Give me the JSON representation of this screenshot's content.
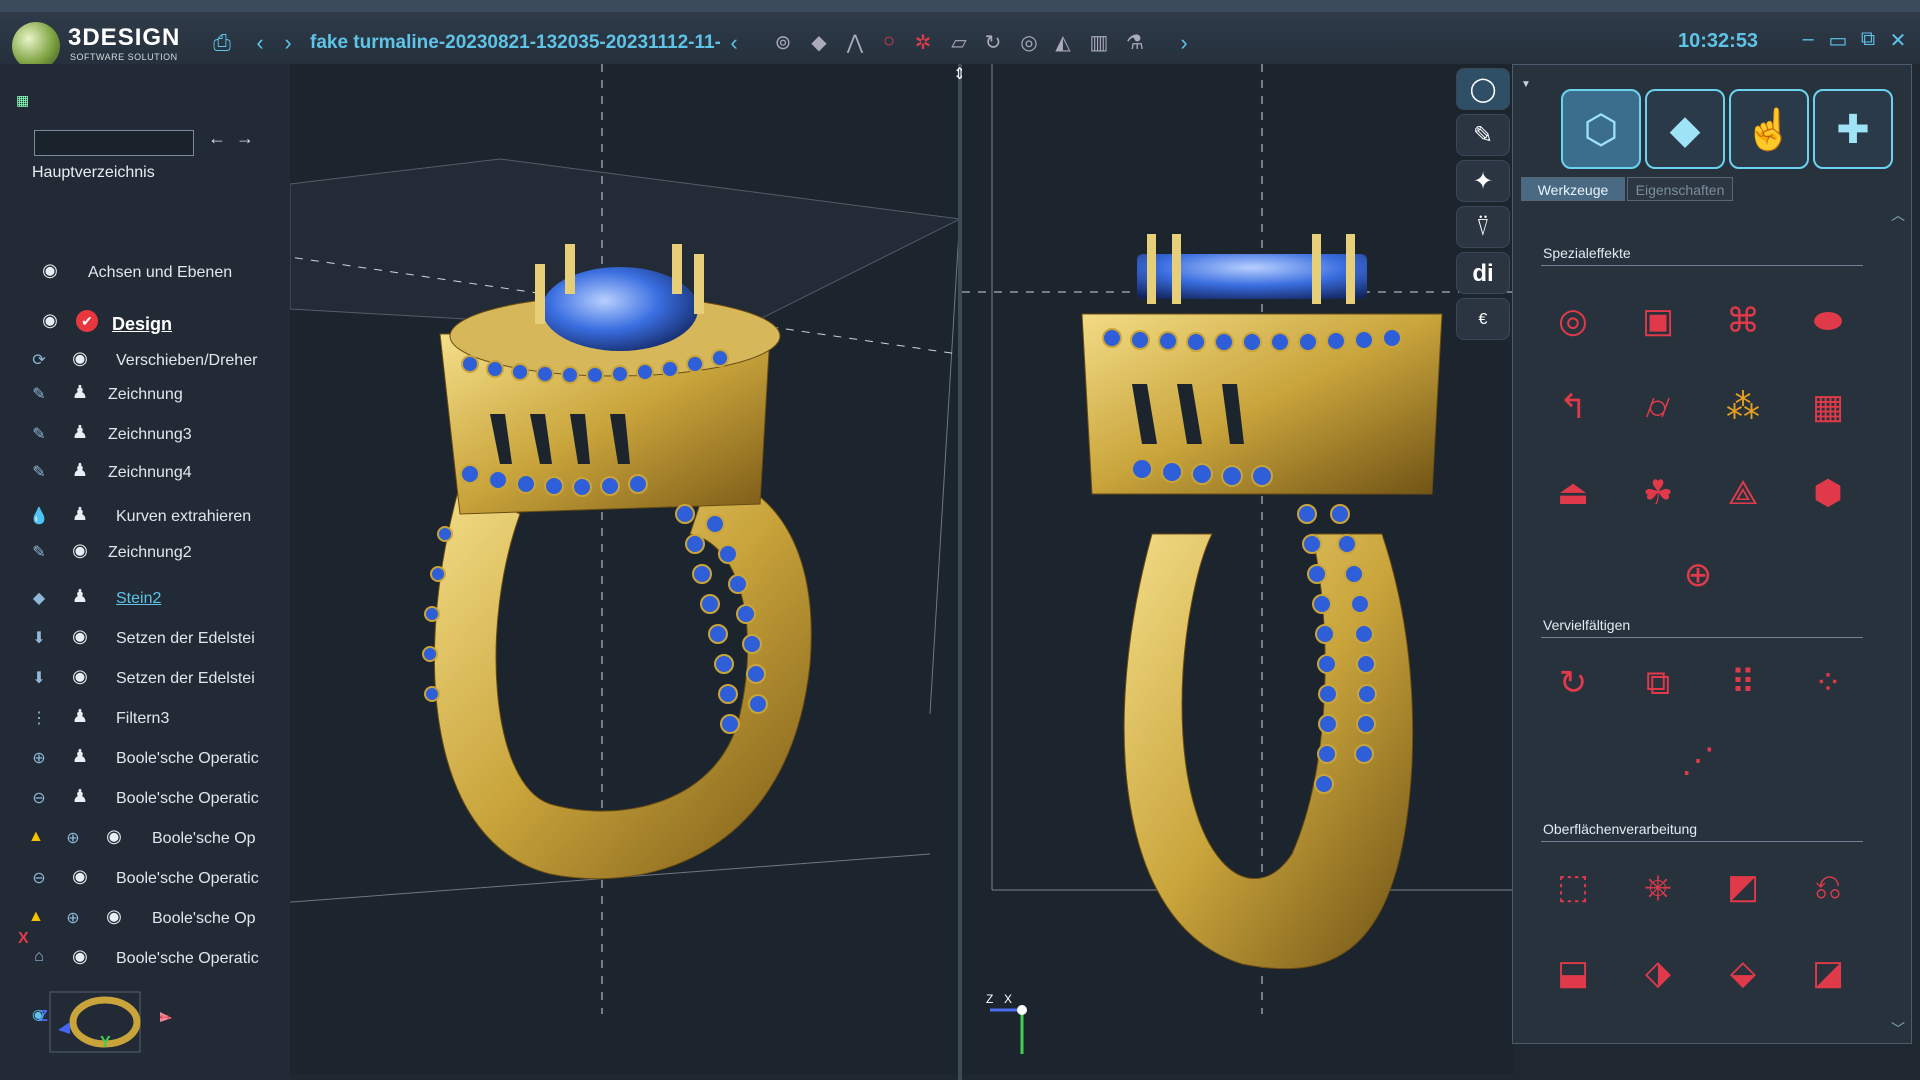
{
  "app": {
    "brand": "3DESIGN",
    "brand_sub": "SOFTWARE SOLUTION",
    "document_title": "fake turmaline-20230821-132035-20231112-11-",
    "clock": "10:32:53"
  },
  "colors": {
    "accent": "#5fc3e8",
    "icon_red": "#e03a4a",
    "gold": "#c9a43b",
    "sapphire": "#2f5fd8"
  },
  "tree": {
    "root": "Hauptverzeichnis",
    "items": [
      {
        "label": "Achsen und Ebenen",
        "icon": "eye-icon"
      },
      {
        "label": "Design",
        "icon": "check-icon"
      },
      {
        "label": "Verschieben/Dreher",
        "icon": "move-rotate-icon"
      },
      {
        "label": "Zeichnung",
        "icon": "pencil-icon"
      },
      {
        "label": "Zeichnung3",
        "icon": "pencil-icon"
      },
      {
        "label": "Zeichnung4",
        "icon": "pencil-icon"
      },
      {
        "label": "Kurven extrahieren",
        "icon": "drop-icon"
      },
      {
        "label": "Zeichnung2",
        "icon": "pencil-icon"
      },
      {
        "label": "Stein2",
        "icon": "gem-icon"
      },
      {
        "label": "Setzen der Edelstei",
        "icon": "set-gem-icon"
      },
      {
        "label": "Setzen der Edelstei",
        "icon": "set-gem-icon"
      },
      {
        "label": "Filtern3",
        "icon": "filter-icon"
      },
      {
        "label": "Boole'sche Operatic",
        "icon": "boolean-union-icon"
      },
      {
        "label": "Boole'sche Operatic",
        "icon": "boolean-subtract-icon"
      },
      {
        "label": "Boole'sche Op",
        "icon": "boolean-union-icon"
      },
      {
        "label": "Boole'sche Operatic",
        "icon": "boolean-subtract-icon"
      },
      {
        "label": "Boole'sche Op",
        "icon": "boolean-union-icon"
      },
      {
        "label": "Boole'sche Operatic",
        "icon": "home-icon"
      }
    ]
  },
  "axes": {
    "x": "X",
    "y": "Y",
    "z": "Z"
  },
  "right_panel": {
    "tabs": [
      "Werkzeuge",
      "Eigenschaften"
    ],
    "sections": [
      {
        "title": "Spezialeffekte"
      },
      {
        "title": "Vervielfältigen"
      },
      {
        "title": "Oberflächenverarbeitung"
      }
    ]
  },
  "viewport_axes": {
    "z": "Z",
    "x": "X"
  }
}
